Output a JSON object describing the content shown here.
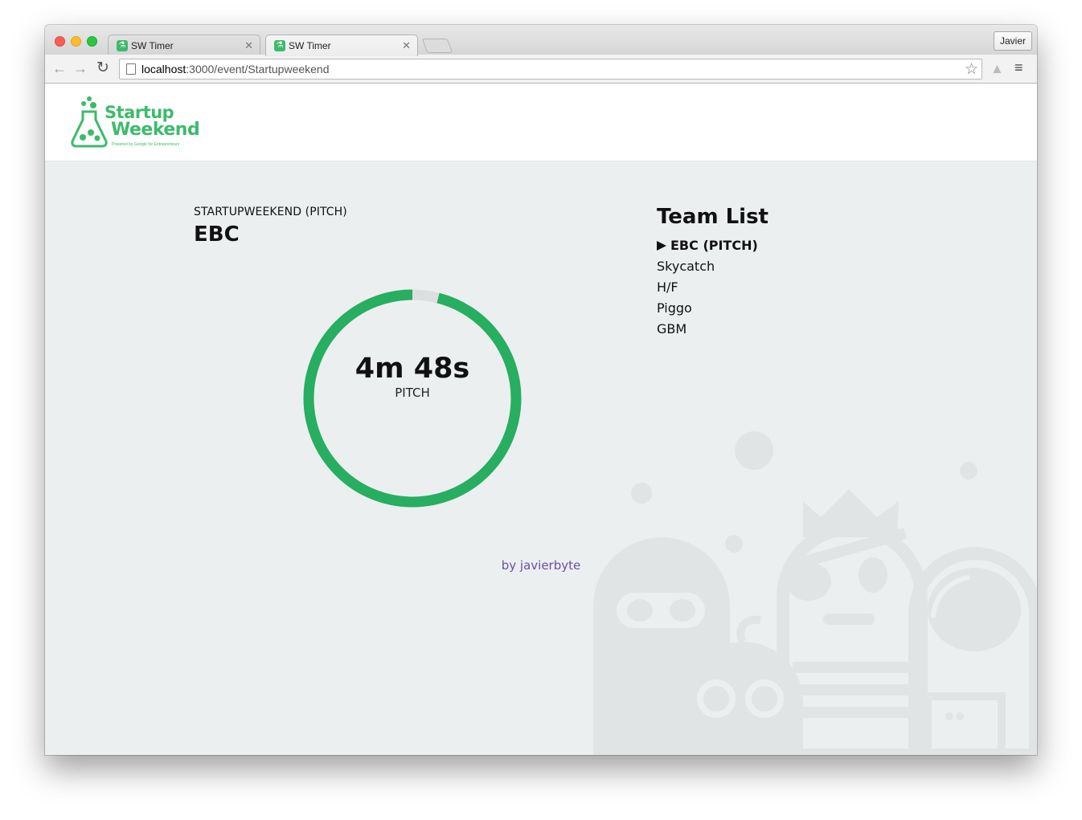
{
  "browser": {
    "tabs": [
      {
        "title": "SW Timer",
        "active": false
      },
      {
        "title": "SW Timer",
        "active": true
      }
    ],
    "profile": "Javier",
    "url_host": "localhost",
    "url_path": ":3000/event/Startupweekend"
  },
  "header": {
    "logo_line1": "Startup",
    "logo_line2": "Weekend",
    "logo_tagline": "Powered by Google for Entrepreneurs"
  },
  "main": {
    "event_label": "STARTUPWEEKEND (PITCH)",
    "current_team": "EBC",
    "timer": {
      "value": "4m 48s",
      "phase": "PITCH",
      "remaining_fraction": 0.96
    }
  },
  "team_list": {
    "title": "Team List",
    "teams": [
      {
        "name": "EBC (PITCH)",
        "current": true
      },
      {
        "name": "Skycatch",
        "current": false
      },
      {
        "name": "H/F",
        "current": false
      },
      {
        "name": "Piggo",
        "current": false
      },
      {
        "name": "GBM",
        "current": false
      }
    ]
  },
  "footer": {
    "credit": "by javierbyte"
  },
  "colors": {
    "accent": "#27ae60",
    "track": "#dcdedf",
    "credit": "#6a4fa3",
    "background": "#eceff0"
  }
}
